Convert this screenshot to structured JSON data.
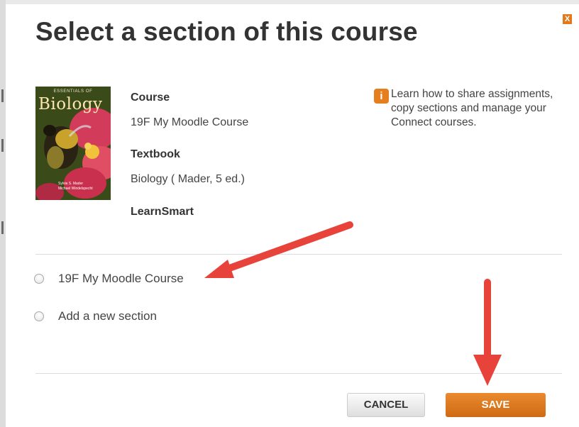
{
  "dialog": {
    "title": "Select a section of this course",
    "close_label": "X"
  },
  "book": {
    "series": "ESSENTIALS OF",
    "title": "Biology",
    "authors": [
      "Sylvia S. Mader",
      "Michael Windelspecht"
    ]
  },
  "course": {
    "course_label": "Course",
    "course_value": "19F My Moodle Course",
    "textbook_label": "Textbook",
    "textbook_value": "Biology ( Mader, 5 ed.)",
    "learnsmart_label": "LearnSmart"
  },
  "info": {
    "icon": "info-icon",
    "text": "Learn how to share assignments, copy sections and manage your Connect courses."
  },
  "sections": {
    "options": [
      {
        "label": "19F My Moodle Course",
        "selected": false
      },
      {
        "label": "Add a new section",
        "selected": false
      }
    ]
  },
  "buttons": {
    "cancel": "CANCEL",
    "save": "SAVE"
  },
  "colors": {
    "accent": "#e07a1c",
    "annotation_arrow": "#e8433a"
  }
}
